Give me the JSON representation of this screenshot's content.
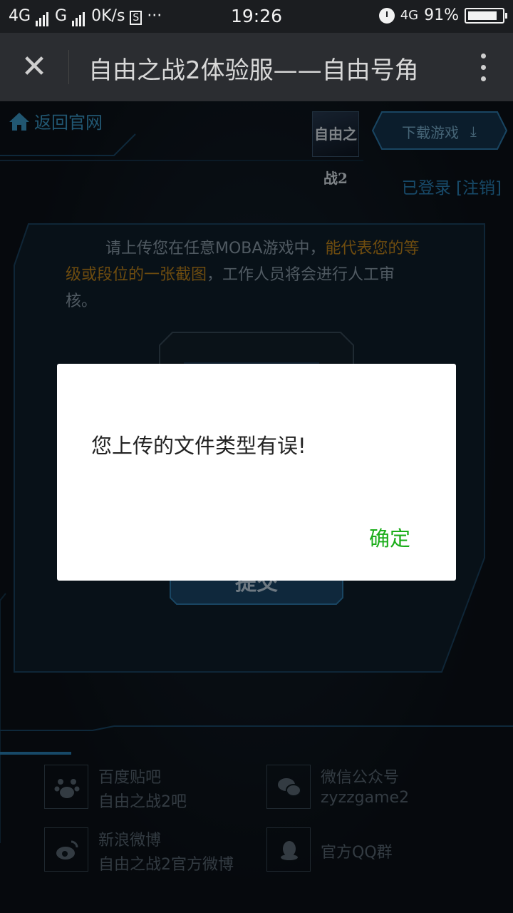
{
  "status_bar": {
    "network_1": "4G",
    "network_2": "G",
    "speed": "0K/s",
    "extra_icon": "S",
    "dots": "···",
    "time": "19:26",
    "network_3": "4G",
    "battery_percent_text": "91%",
    "battery_level": 0.91
  },
  "title_bar": {
    "close_icon": "close-icon",
    "title": "自由之战2体验服——自由号角",
    "menu_icon": "more-vertical-icon"
  },
  "nav": {
    "back_label": "返回官网",
    "logo_text": "自由之战2",
    "download_label": "下载游戏",
    "login_status": "已登录 [注销]"
  },
  "panel": {
    "text_before": "请上传您在任意MOBA游戏中，",
    "text_highlight": "能代表您的等级或段位的一张截图",
    "text_after": "，工作人员将会进行人工审核。",
    "submit_label": "提交"
  },
  "footer": {
    "items": [
      {
        "icon": "baidu-paw-icon",
        "line1": "百度贴吧",
        "line2": "自由之战2吧"
      },
      {
        "icon": "wechat-icon",
        "line1": "微信公众号",
        "line2": "zyzzgame2"
      },
      {
        "icon": "weibo-icon",
        "line1": "新浪微博",
        "line2": "自由之战2官方微博"
      },
      {
        "icon": "qq-icon",
        "line1": "官方QQ群",
        "line2": ""
      }
    ]
  },
  "dialog": {
    "message": "您上传的文件类型有误!",
    "confirm_label": "确定",
    "confirm_color": "#1aad19"
  },
  "colors": {
    "accent": "#3d9ed0",
    "highlight": "#c98a1c"
  }
}
